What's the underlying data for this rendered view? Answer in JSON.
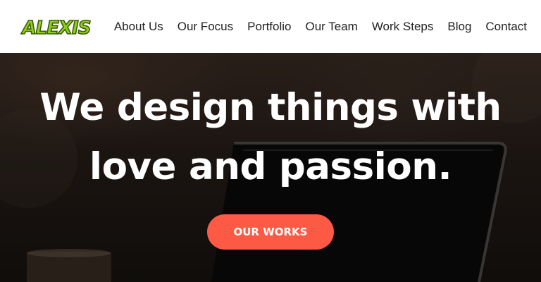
{
  "header": {
    "logo_text": "ALEXIS",
    "nav": [
      {
        "label": "About Us"
      },
      {
        "label": "Our Focus"
      },
      {
        "label": "Portfolio"
      },
      {
        "label": "Our Team"
      },
      {
        "label": "Work Steps"
      },
      {
        "label": "Blog"
      },
      {
        "label": "Contact"
      }
    ]
  },
  "hero": {
    "title": "We design things with love and passion.",
    "cta_label": "OUR WORKS"
  },
  "colors": {
    "accent": "#fc5a45",
    "logo_green": "#8fd11a",
    "nav_text": "#222222"
  }
}
